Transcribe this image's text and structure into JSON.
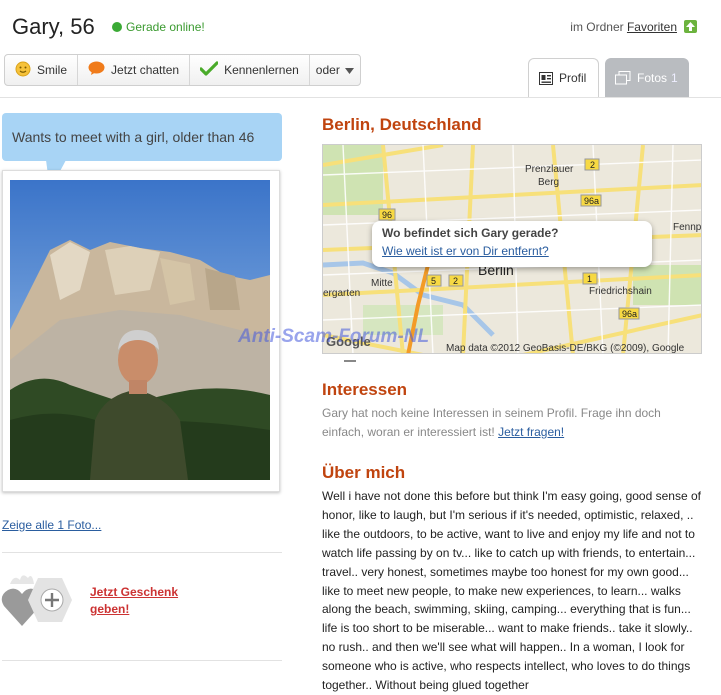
{
  "header": {
    "name_age": "Gary, 56",
    "online_status": "Gerade online!",
    "folder_prefix": "im Ordner",
    "folder_link": "Favoriten"
  },
  "actions": {
    "smile": "Smile",
    "chat": "Jetzt chatten",
    "meet": "Kennenlernen",
    "more": "oder"
  },
  "tabs": {
    "profile": "Profil",
    "photos": "Fotos",
    "photos_count": "1"
  },
  "left": {
    "bubble": "Wants to meet with a girl, older than 46",
    "show_photos": "Zeige alle 1 Foto...",
    "gift": "Jetzt Geschenk geben!"
  },
  "location": {
    "title": "Berlin, Deutschland",
    "map_question": "Wo befindet sich Gary gerade?",
    "map_link": "Wie weit ist er von Dir entfernt?",
    "map_copyright": "Map data ©2012 GeoBasis-DE/BKG (©2009), Google",
    "map_google": "Google",
    "map_labels": {
      "prenzlauer": "Prenzlauer",
      "berg": "Berg",
      "berlin": "Berlin",
      "mitte": "Mitte",
      "friedrichshain": "Friedrichshain",
      "fennp": "Fennp",
      "ergarten": "ergarten",
      "b96": "96",
      "b96a": "96a",
      "b2": "2",
      "b1": "1",
      "b5": "5"
    },
    "watermark": "Anti-Scam-Forum-NL"
  },
  "interests": {
    "title": "Interessen",
    "text": "Gary hat noch keine Interessen in seinem Profil. Frage ihn doch einfach, woran er interessiert ist!",
    "link": "Jetzt fragen!"
  },
  "about": {
    "title": "Über mich",
    "text": "Well i have not done this before but think I'm easy going, good sense of honor, like to laugh, but I'm serious if it's needed, optimistic, relaxed, .. like the outdoors, to be active, want to live and enjoy my life and not to watch life passing by on tv... like to catch up with friends, to entertain... travel.. very honest, sometimes maybe too honest for my own good... like to meet new people, to make new experiences, to learn... walks along the beach, swimming, skiing, camping... everything that is fun... life is too short to be miserable... want to make friends.. take it slowly.. no rush.. and then we'll see what will happen.. In a woman, I look for someone who is active, who respects intellect, who loves to do things together.. Without being glued together"
  },
  "colors": {
    "accent": "#c0440f",
    "online": "#3aaa35",
    "bubble": "#a8d4f5",
    "link": "#2a5d9f"
  },
  "icons": [
    "smile-icon",
    "chat-icon",
    "check-icon",
    "dropdown-arrow-icon",
    "profile-icon",
    "photos-icon",
    "upload-arrow-icon",
    "heart-plus-icon"
  ]
}
